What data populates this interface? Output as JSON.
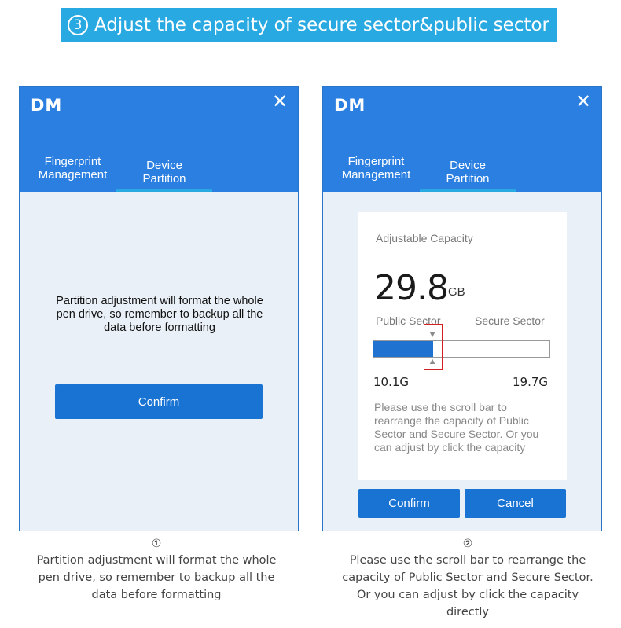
{
  "banner": {
    "number": "3",
    "title": "Adjust  the capacity of secure sector&public sector"
  },
  "window1": {
    "logo": "DM",
    "close_symbol": "✕",
    "tabs": [
      {
        "label_line1": "Fingerprint",
        "label_line2": "Management"
      },
      {
        "label_line1": "Device",
        "label_line2": "Partition",
        "active": true
      }
    ],
    "notice_lines": [
      "Partition adjustment will format the whole",
      "pen drive, so remember to backup all the",
      "data before formatting"
    ],
    "confirm_label": "Confirm"
  },
  "window2": {
    "logo": "DM",
    "close_symbol": "✕",
    "tabs": [
      {
        "label_line1": "Fingerprint",
        "label_line2": "Management"
      },
      {
        "label_line1": "Device",
        "label_line2": "Partition",
        "active": true
      }
    ],
    "adjustable_title": "Adjustable Capacity",
    "capacity_value": "29.8",
    "capacity_unit": "GB",
    "public_label": "Public  Sector",
    "secure_label": "Secure  Sector",
    "public_value": "10.1G",
    "secure_value": "19.7G",
    "public_fraction": 0.339,
    "hint_lines": [
      "Please use the scroll bar to",
      "rearrange the capacity of Public",
      "Sector and Secure Sector. Or you",
      "can adjust  by click the capacity"
    ],
    "confirm_label": "Confirm",
    "cancel_label": "Cancel"
  },
  "captions": [
    {
      "number": "①",
      "lines": [
        "Partition adjustment will format the whole",
        "pen drive, so remember to backup all the",
        "data before formatting"
      ]
    },
    {
      "number": "②",
      "lines": [
        "Please use the scroll bar to rearrange the",
        "capacity of Public Sector and Secure Sector.",
        "Or you can adjust  by click the capacity",
        "directly"
      ]
    }
  ],
  "colors": {
    "banner": "#29a9e1",
    "titlebar": "#2b7fe0",
    "button": "#1873d3",
    "bar_fill": "#1f72cf",
    "marker": "#d32020"
  }
}
